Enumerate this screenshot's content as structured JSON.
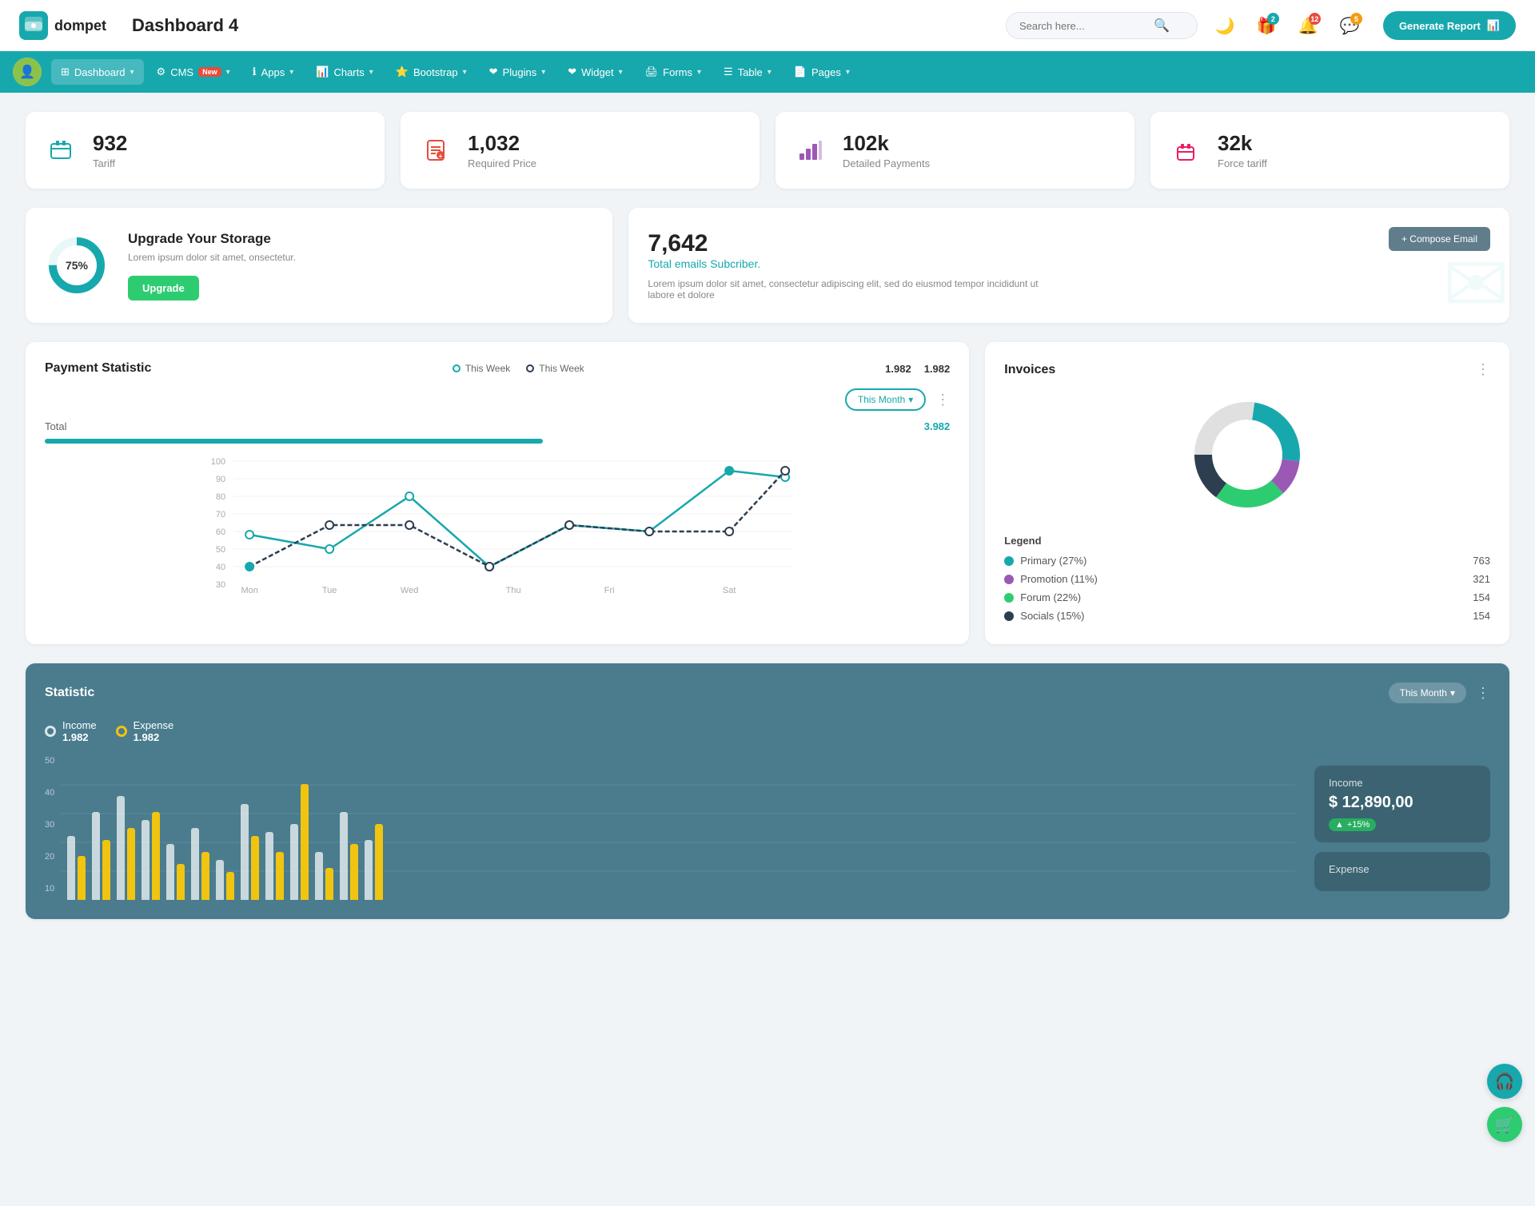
{
  "header": {
    "logo_letter": "c",
    "logo_name": "dompet",
    "page_title": "Dashboard 4",
    "search_placeholder": "Search here...",
    "generate_btn": "Generate Report",
    "icons": {
      "moon": "🌙",
      "gift": "🎁",
      "bell_badge": "2",
      "chat_badge": "12",
      "email_badge": "5"
    }
  },
  "nav": {
    "items": [
      {
        "label": "Dashboard",
        "active": true,
        "icon": "⊞"
      },
      {
        "label": "CMS",
        "active": false,
        "icon": "⚙",
        "badge": "New"
      },
      {
        "label": "Apps",
        "active": false,
        "icon": "ℹ"
      },
      {
        "label": "Charts",
        "active": false,
        "icon": "📊"
      },
      {
        "label": "Bootstrap",
        "active": false,
        "icon": "⭐"
      },
      {
        "label": "Plugins",
        "active": false,
        "icon": "❤"
      },
      {
        "label": "Widget",
        "active": false,
        "icon": "❤"
      },
      {
        "label": "Forms",
        "active": false,
        "icon": "🖨"
      },
      {
        "label": "Table",
        "active": false,
        "icon": "☰"
      },
      {
        "label": "Pages",
        "active": false,
        "icon": "📄"
      }
    ]
  },
  "stat_cards": [
    {
      "value": "932",
      "label": "Tariff",
      "icon": "briefcase",
      "color": "teal"
    },
    {
      "value": "1,032",
      "label": "Required Price",
      "icon": "file",
      "color": "red"
    },
    {
      "value": "102k",
      "label": "Detailed Payments",
      "icon": "chart",
      "color": "purple"
    },
    {
      "value": "32k",
      "label": "Force tariff",
      "icon": "building",
      "color": "pink"
    }
  ],
  "storage": {
    "percent": "75%",
    "title": "Upgrade Your Storage",
    "description": "Lorem ipsum dolor sit amet, onsectetur.",
    "btn_label": "Upgrade",
    "donut_value": 75
  },
  "email": {
    "number": "7,642",
    "subtitle": "Total emails Subcriber.",
    "description": "Lorem ipsum dolor sit amet, consectetur adipiscing elit, sed do eiusmod tempor incididunt ut labore et dolore",
    "compose_btn": "+ Compose Email"
  },
  "payment_statistic": {
    "title": "Payment Statistic",
    "legend1_label": "This Week",
    "legend1_value": "1.982",
    "legend2_label": "This Week",
    "legend2_value": "1.982",
    "filter_label": "This Month",
    "total_label": "Total",
    "total_value": "3.982",
    "x_labels": [
      "Mon",
      "Tue",
      "Wed",
      "Thu",
      "Fri",
      "Sat"
    ],
    "y_labels": [
      "100",
      "90",
      "80",
      "70",
      "60",
      "50",
      "40",
      "30"
    ],
    "line1": [
      60,
      50,
      80,
      40,
      65,
      60,
      90,
      85
    ],
    "line2": [
      40,
      68,
      70,
      40,
      65,
      65,
      65,
      90
    ]
  },
  "invoices": {
    "title": "Invoices",
    "legend_title": "Legend",
    "items": [
      {
        "label": "Primary (27%)",
        "color": "#17a8ad",
        "value": "763"
      },
      {
        "label": "Promotion (11%)",
        "color": "#9b59b6",
        "value": "321"
      },
      {
        "label": "Forum (22%)",
        "color": "#2ecc71",
        "value": "154"
      },
      {
        "label": "Socials (15%)",
        "color": "#2c3e50",
        "value": "154"
      }
    ]
  },
  "statistic": {
    "title": "Statistic",
    "filter_label": "This Month",
    "y_labels": [
      "50",
      "40",
      "30",
      "20",
      "10"
    ],
    "income_label": "Income",
    "income_value": "1.982",
    "expense_label": "Expense",
    "expense_value": "1.982",
    "income_box": {
      "title": "Income",
      "value": "$ 12,890,00",
      "badge": "+15%"
    },
    "expense_box": {
      "title": "Expense"
    }
  },
  "float_btns": {
    "support_icon": "🎧",
    "cart_icon": "🛒"
  }
}
